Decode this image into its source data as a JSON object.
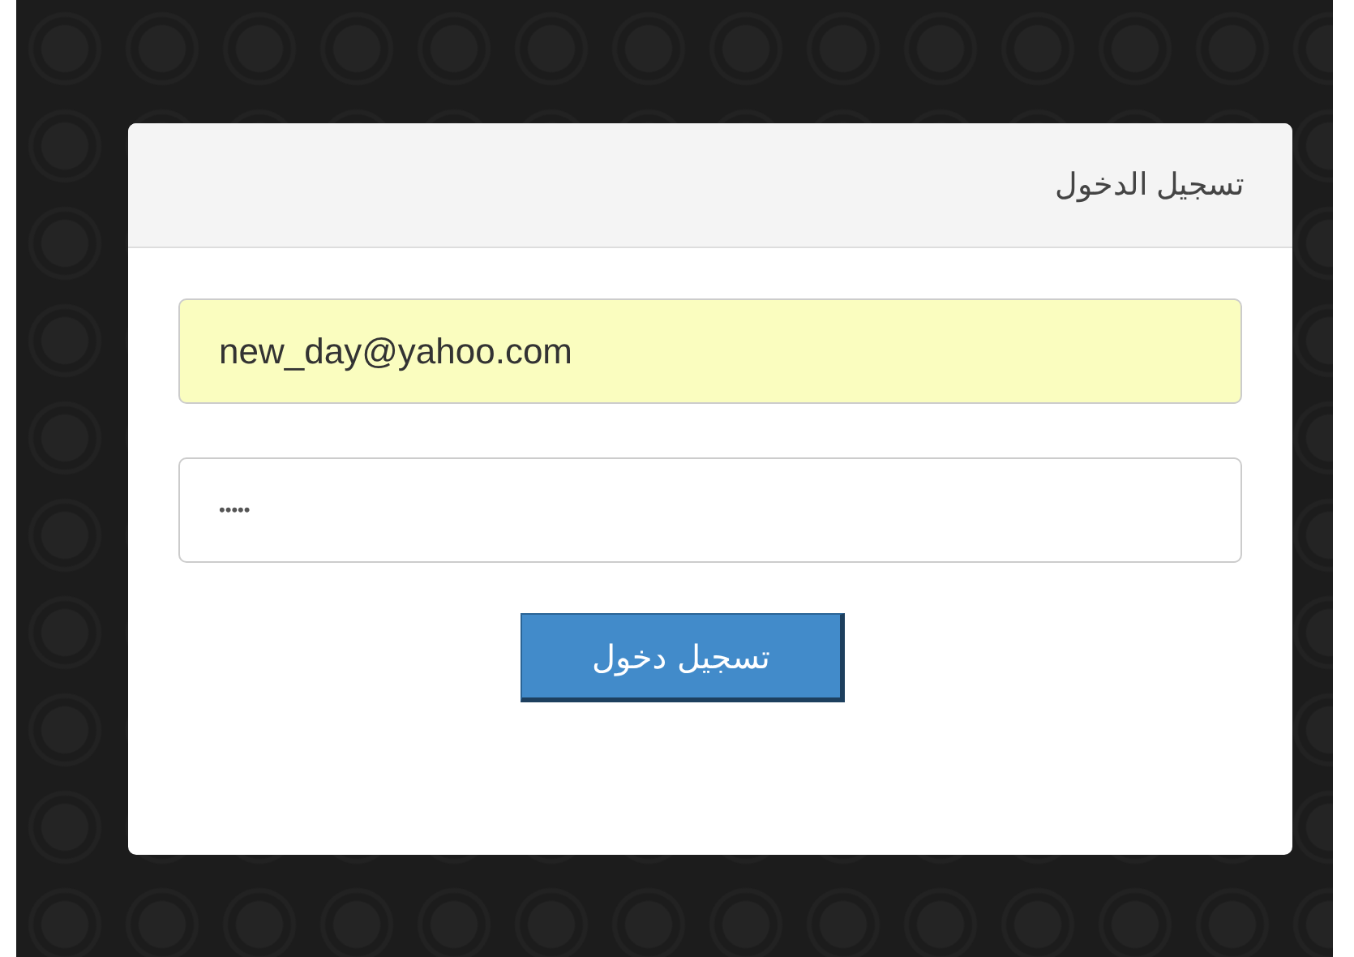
{
  "panel": {
    "title": "تسجيل الدخول"
  },
  "fields": [
    {
      "kind": "email",
      "value": "new_day@yahoo.com",
      "autofilled": true
    },
    {
      "kind": "password",
      "value": "•••••",
      "autofilled": false
    }
  ],
  "submit_button": "تسجيل دخول"
}
